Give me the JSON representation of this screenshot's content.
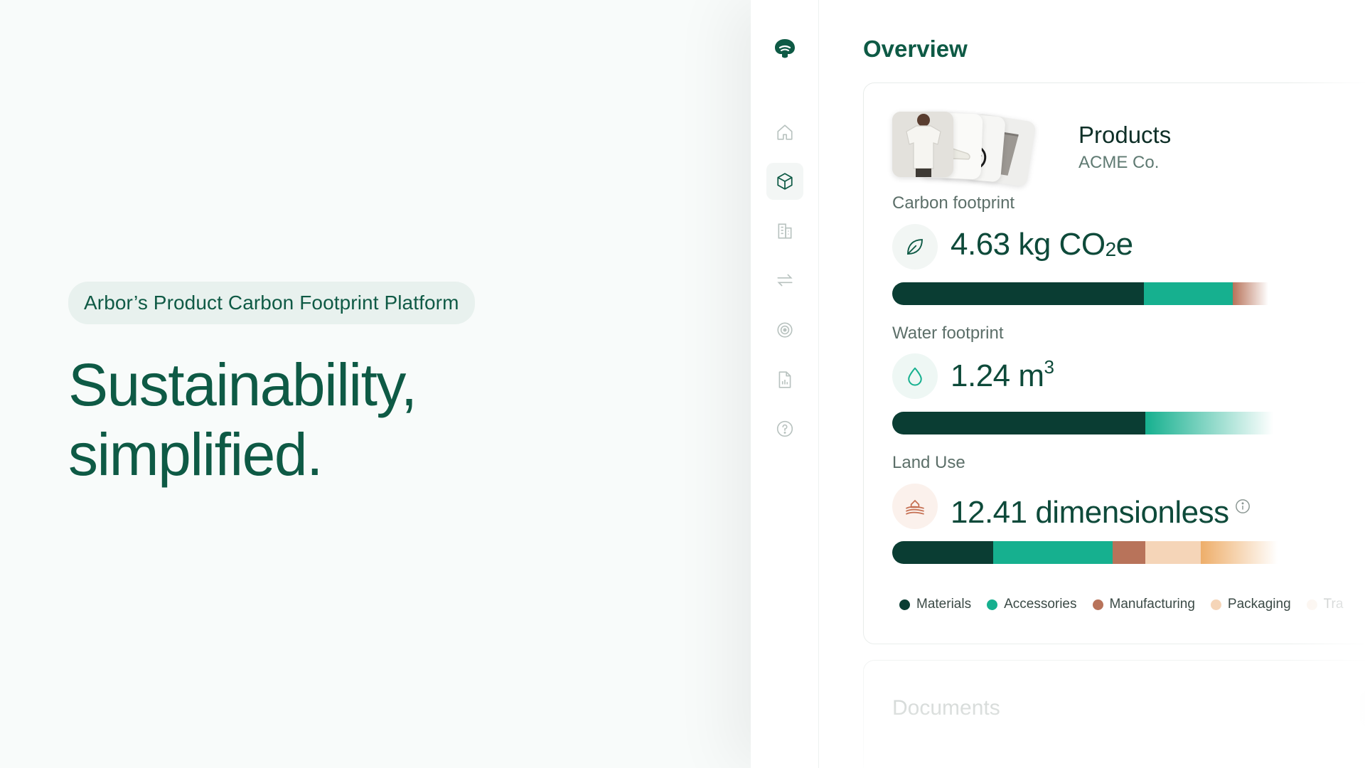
{
  "hero": {
    "badge": "Arbor’s Product Carbon Footprint Platform",
    "title": "Sustainability,\nsimplified."
  },
  "sidebar": {
    "logo_icon": "arbor-tree-logo",
    "items": [
      {
        "icon": "home-icon",
        "active": false
      },
      {
        "icon": "box-icon",
        "active": true
      },
      {
        "icon": "buildings-icon",
        "active": false
      },
      {
        "icon": "arrows-exchange-icon",
        "active": false
      },
      {
        "icon": "target-icon",
        "active": false
      },
      {
        "icon": "report-document-icon",
        "active": false
      },
      {
        "icon": "help-circle-icon",
        "active": false
      }
    ]
  },
  "main": {
    "title": "Overview",
    "products_card": {
      "title": "Products",
      "subtitle": "ACME Co.",
      "thumbnails": [
        "t-shirt",
        "sneaker",
        "bicycle",
        "cup"
      ],
      "metrics": [
        {
          "label": "Carbon footprint",
          "value_prefix": "4.63 kg CO",
          "value_sub": "2",
          "value_suffix": "e",
          "icon": "leaf-icon",
          "segments": [
            {
              "category": "Materials",
              "share": 0.4915
            },
            {
              "category": "Accessories",
              "share": 0.1735
            },
            {
              "category": "Manufacturing",
              "share": 0.07
            }
          ]
        },
        {
          "label": "Water footprint",
          "value_prefix": "1.24 m",
          "value_sup": "3",
          "icon": "water-drop-icon",
          "segments": [
            {
              "category": "Materials",
              "share": 0.494
            },
            {
              "category": "Accessories",
              "share": 0.25
            }
          ]
        },
        {
          "label": "Land Use",
          "value_prefix": "12.41 dimensionless",
          "icon": "land-field-icon",
          "info_icon": "info-icon",
          "segments": [
            {
              "category": "Materials",
              "share": 0.197
            },
            {
              "category": "Accessories",
              "share": 0.233
            },
            {
              "category": "Manufacturing",
              "share": 0.065
            },
            {
              "category": "Packaging",
              "share": 0.108
            },
            {
              "category": "Transport",
              "share": 0.15
            }
          ]
        }
      ],
      "legend": [
        {
          "label": "Materials",
          "color": "#0a3d33"
        },
        {
          "label": "Accessories",
          "color": "#16b08f"
        },
        {
          "label": "Manufacturing",
          "color": "#b8735a"
        },
        {
          "label": "Packaging",
          "color": "#f5d5b8"
        },
        {
          "label": "Tra",
          "color": "#f7e6d6"
        }
      ]
    },
    "documents_card": {
      "title": "Documents"
    }
  },
  "colors": {
    "brand": "#0e5a45",
    "materials": "#0a3d33",
    "accessories": "#16b08f",
    "manufacturing": "#b8735a",
    "packaging": "#f5d5b8",
    "transport": "#eeae6a"
  }
}
